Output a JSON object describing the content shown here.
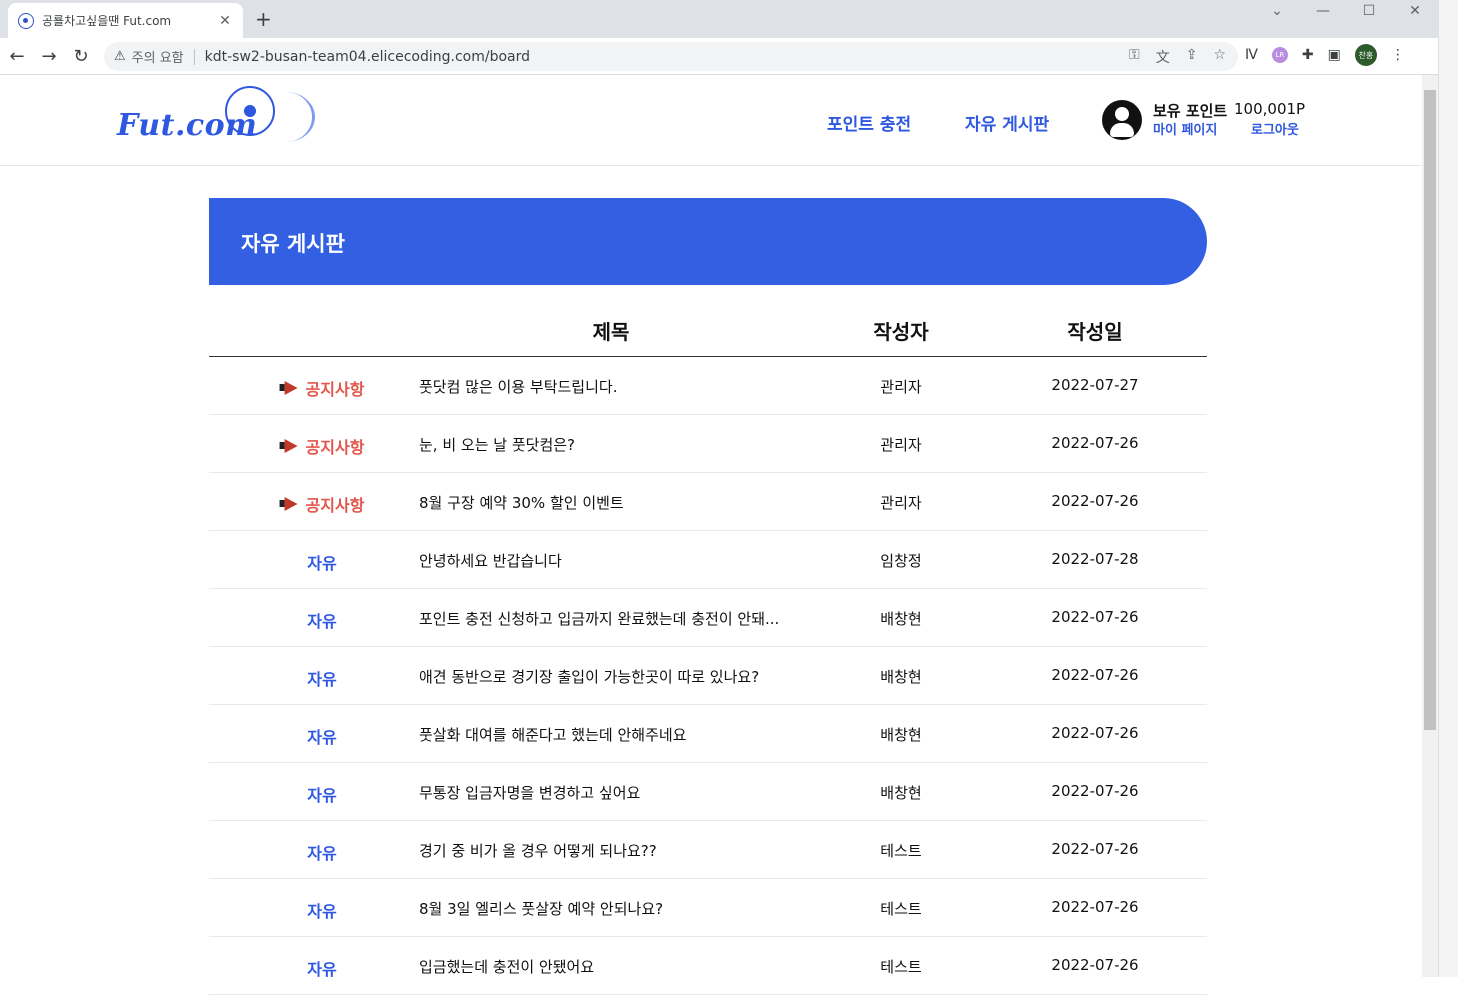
{
  "browser": {
    "tab_title": "공룔차고싶을땐 Fut.com",
    "tab_close": "✕",
    "new_tab": "+",
    "warning_label": "주의 요함",
    "url": "kdt-sw2-busan-team04.elicecoding.com/board",
    "profile_initials": "찬홍",
    "lr_badge": "LR"
  },
  "header": {
    "logo_text": "Fut.com",
    "nav": [
      {
        "label": "포인트 충전"
      },
      {
        "label": "자유 게시판"
      }
    ],
    "user": {
      "points_label": "보유 포인트",
      "points_value": "100,001P",
      "mypage": "마이 페이지",
      "logout": "로그아웃"
    }
  },
  "board": {
    "title": "자유 게시판",
    "columns": {
      "title": "제목",
      "author": "작성자",
      "date": "작성일"
    },
    "posts": [
      {
        "category": "공지사항",
        "type": "notice",
        "title": "풋닷컴 많은 이용 부탁드립니다.",
        "author": "관리자",
        "date": "2022-07-27"
      },
      {
        "category": "공지사항",
        "type": "notice",
        "title": "눈, 비 오는 날 풋닷컴은?",
        "author": "관리자",
        "date": "2022-07-26"
      },
      {
        "category": "공지사항",
        "type": "notice",
        "title": "8월 구장 예약 30% 할인 이벤트",
        "author": "관리자",
        "date": "2022-07-26"
      },
      {
        "category": "자유",
        "type": "free",
        "title": "안녕하세요 반갑습니다",
        "author": "임창정",
        "date": "2022-07-28"
      },
      {
        "category": "자유",
        "type": "free",
        "title": "포인트 충전 신청하고 입금까지 완료했는데 충전이 안돼...",
        "author": "배창현",
        "date": "2022-07-26"
      },
      {
        "category": "자유",
        "type": "free",
        "title": "애견 동반으로 경기장 출입이 가능한곳이 따로 있나요?",
        "author": "배창현",
        "date": "2022-07-26"
      },
      {
        "category": "자유",
        "type": "free",
        "title": "풋살화 대여를 해준다고 했는데 안해주네요",
        "author": "배창현",
        "date": "2022-07-26"
      },
      {
        "category": "자유",
        "type": "free",
        "title": "무통장 입금자명을 변경하고 싶어요",
        "author": "배창현",
        "date": "2022-07-26"
      },
      {
        "category": "자유",
        "type": "free",
        "title": "경기 중 비가 올 경우 어떻게 되나요??",
        "author": "테스트",
        "date": "2022-07-26"
      },
      {
        "category": "자유",
        "type": "free",
        "title": "8월 3일 엘리스 풋살장 예약 안되나요?",
        "author": "테스트",
        "date": "2022-07-26"
      },
      {
        "category": "자유",
        "type": "free",
        "title": "입금했는데 충전이 안됐어요",
        "author": "테스트",
        "date": "2022-07-26"
      }
    ]
  },
  "colors": {
    "brand": "#2f58e0",
    "banner": "#3360e3",
    "notice": "#e2574c"
  }
}
